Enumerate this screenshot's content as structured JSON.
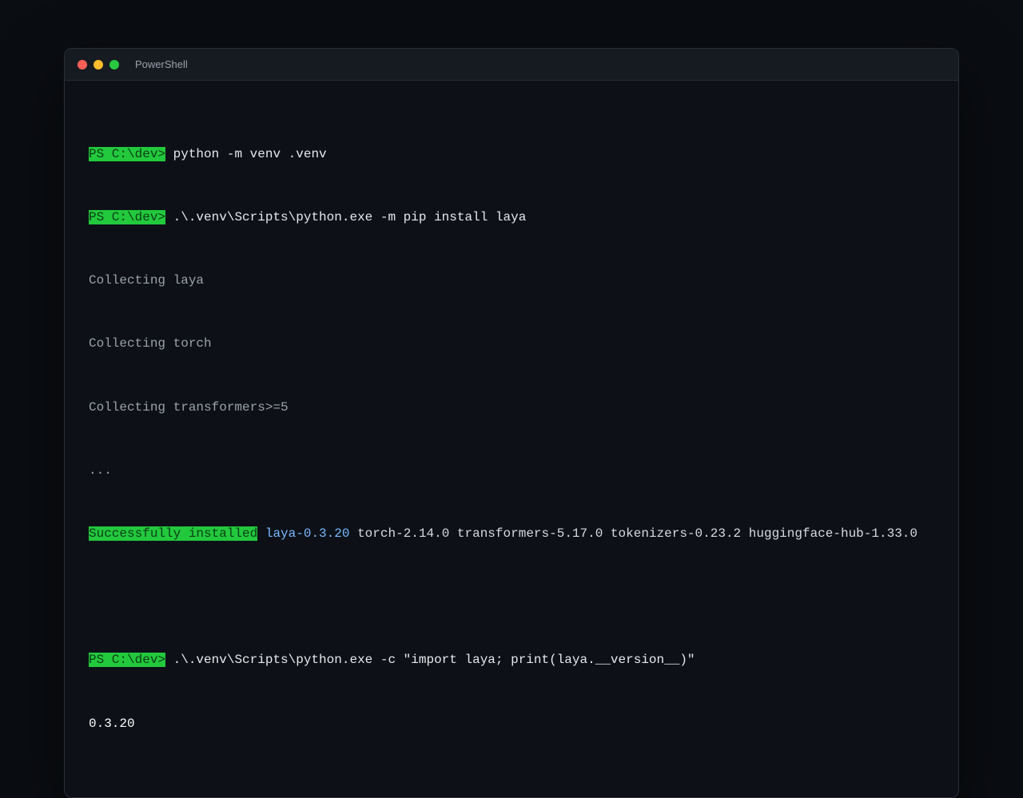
{
  "window": {
    "title": "PowerShell"
  },
  "terminal": {
    "prompt": "PS C:\\dev>",
    "commands": {
      "c1": "python -m venv .venv",
      "c2": ".\\.venv\\Scripts\\python.exe -m pip install laya",
      "c3": ".\\.venv\\Scripts\\python.exe -c \"import laya; print(laya.__version__)\""
    },
    "output": {
      "collect1": "Collecting laya",
      "collect2": "Collecting torch",
      "collect3": "Collecting transformers>=5",
      "ellipsis": "...",
      "success_label": "Successfully installed",
      "pkg_main": "laya-0.3.20",
      "pkg_rest": "torch-2.14.0 transformers-5.17.0 tokenizers-0.23.2 huggingface-hub-1.33.0",
      "version": "0.3.20"
    }
  },
  "colors": {
    "prompt_bg": "#22c93c",
    "accent_package": "#79b8ff",
    "background": "#0d1117"
  }
}
